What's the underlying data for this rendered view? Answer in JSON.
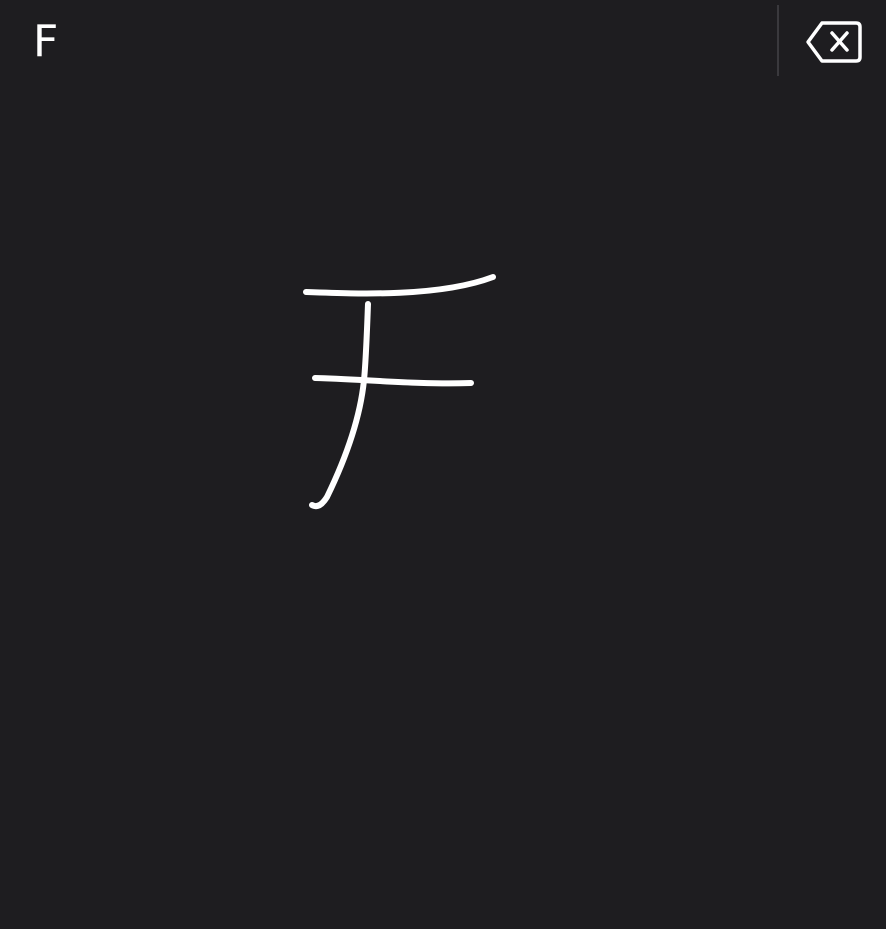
{
  "top_bar": {
    "suggestion_text": "F",
    "delete_icon": "delete-backward-icon"
  },
  "handwriting_canvas": {
    "ink_color": "#ffffff",
    "background_color": "#1e1d20"
  }
}
